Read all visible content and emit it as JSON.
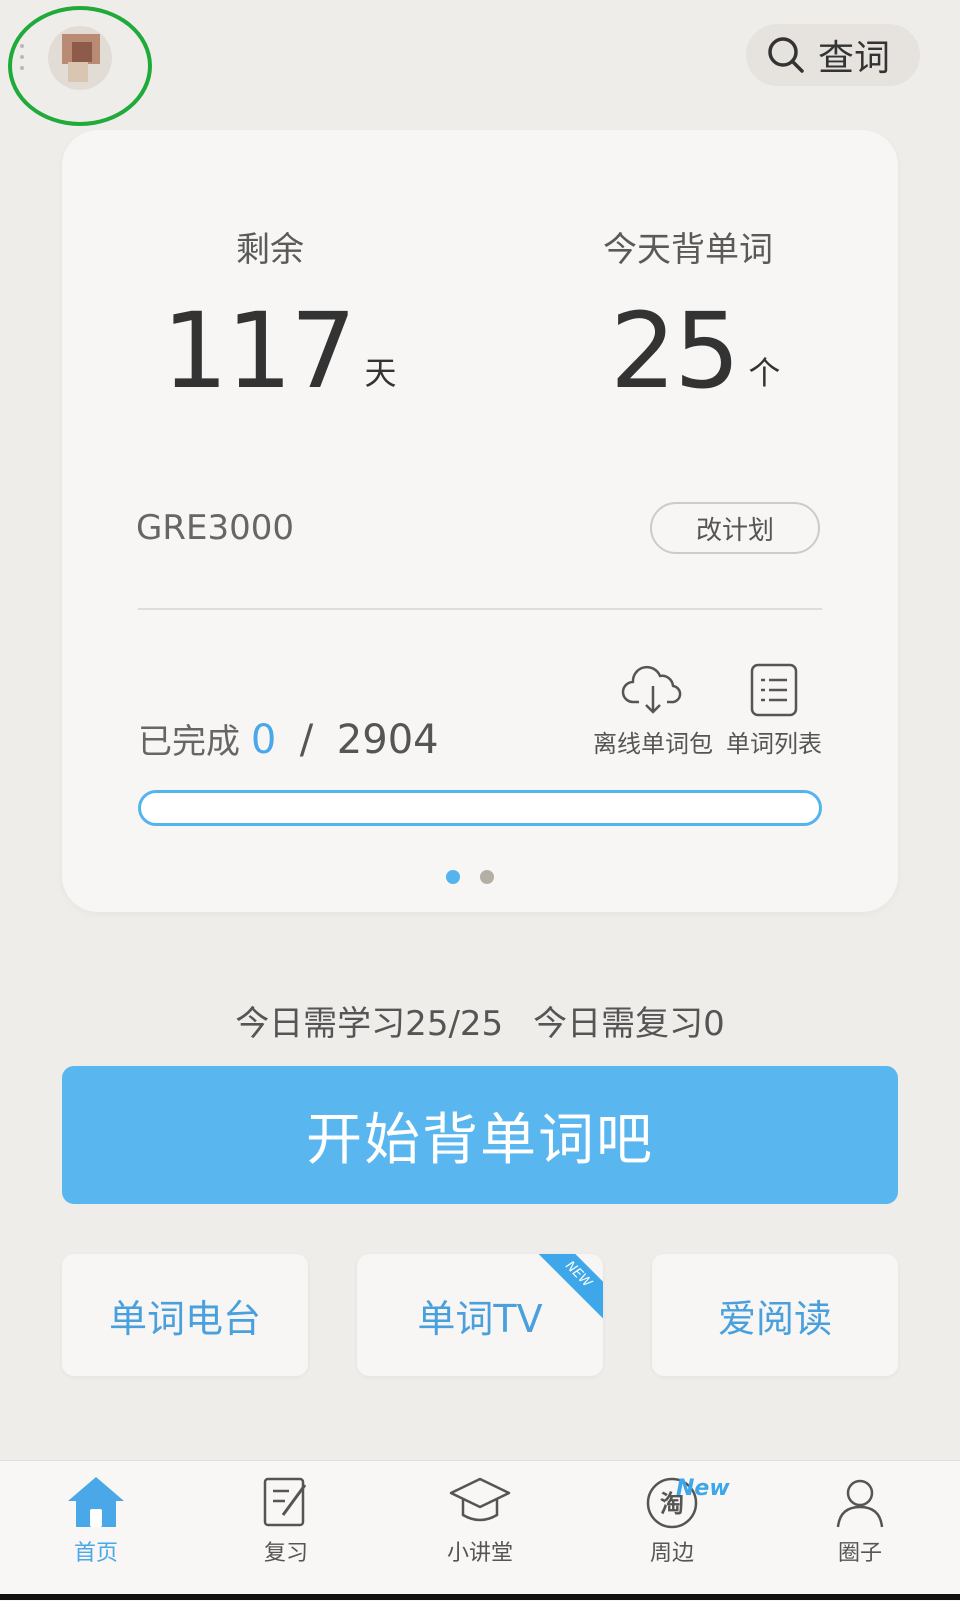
{
  "header": {
    "search_label": "查词"
  },
  "plan": {
    "remaining_label": "剩余",
    "remaining_value": "117",
    "remaining_unit": "天",
    "today_label": "今天背单词",
    "today_value": "25",
    "today_unit": "个",
    "book_name": "GRE3000",
    "change_plan_label": "改计划",
    "completed_label": "已完成",
    "completed_value": "0",
    "completed_sep": " / ",
    "total_value": "2904",
    "progress_fraction": 0,
    "offline_label": "离线单词包",
    "wordlist_label": "单词列表",
    "page_count": 2,
    "active_page": 0
  },
  "summary": {
    "learn_text": "今日需学习25/25",
    "review_text": "今日需复习0"
  },
  "start_button_label": "开始背单词吧",
  "features": [
    {
      "label": "单词电台"
    },
    {
      "label": "单词TV",
      "badge": "NEW"
    },
    {
      "label": "爱阅读"
    }
  ],
  "tabs": [
    {
      "label": "首页",
      "icon": "home-icon",
      "active": true
    },
    {
      "label": "复习",
      "icon": "review-icon"
    },
    {
      "label": "小讲堂",
      "icon": "mortarboard-icon"
    },
    {
      "label": "周边",
      "icon": "taobao-icon",
      "badge": "New"
    },
    {
      "label": "圈子",
      "icon": "people-icon"
    }
  ],
  "colors": {
    "accent": "#54b4ee",
    "background": "#efedea",
    "card": "#f7f6f4",
    "highlight": "#1faa39"
  }
}
